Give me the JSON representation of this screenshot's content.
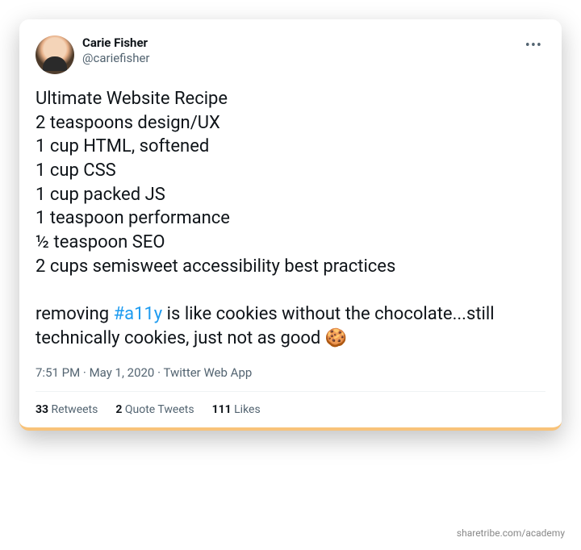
{
  "author": {
    "display_name": "Carie Fisher",
    "handle": "@cariefisher"
  },
  "tweet": {
    "lines": [
      "Ultimate Website Recipe",
      "2 teaspoons design/UX",
      "1 cup HTML, softened",
      "1 cup CSS",
      "1 cup packed JS",
      "1 teaspoon performance",
      "½ teaspoon SEO",
      "2 cups semisweet accessibility best practices"
    ],
    "closing_before": "removing ",
    "hashtag": "#a11y",
    "closing_after": " is like cookies without the chocolate...still technically cookies, just not as good ",
    "emoji": "🍪"
  },
  "meta": {
    "time": "7:51 PM",
    "sep1": " · ",
    "date": "May 1, 2020",
    "sep2": " · ",
    "source": "Twitter Web App"
  },
  "stats": {
    "retweets_count": "33",
    "retweets_label": " Retweets",
    "quotes_count": "2",
    "quotes_label": " Quote Tweets",
    "likes_count": "111",
    "likes_label": " Likes"
  },
  "attribution": "sharetribe.com/academy",
  "more_glyph": "•••"
}
